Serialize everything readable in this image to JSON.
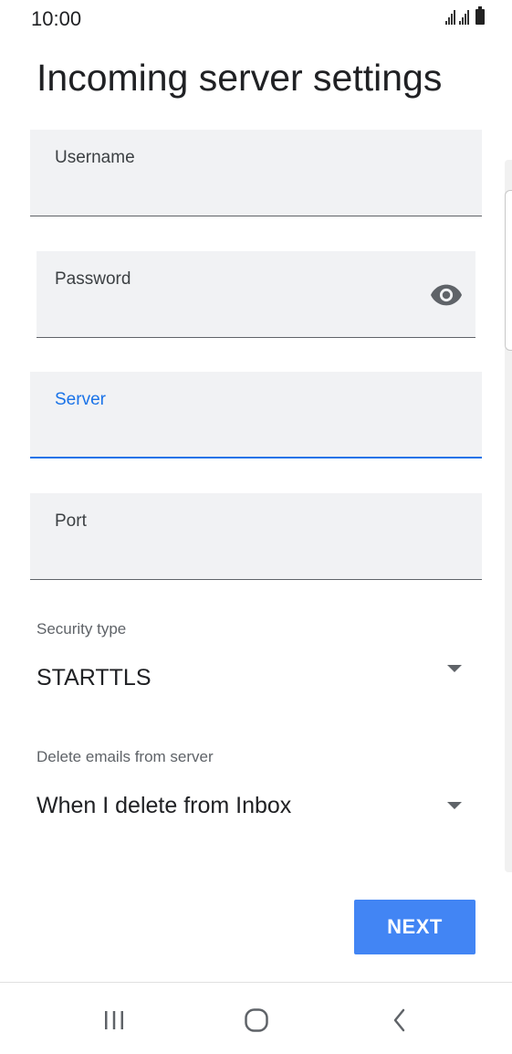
{
  "status_bar": {
    "time": "10:00"
  },
  "page": {
    "title": "Incoming server settings"
  },
  "fields": {
    "username": {
      "label": "Username",
      "value": ""
    },
    "password": {
      "label": "Password",
      "value": ""
    },
    "server": {
      "label": "Server",
      "value": ""
    },
    "port": {
      "label": "Port",
      "value": ""
    }
  },
  "security_type": {
    "label": "Security type",
    "selected": "STARTTLS"
  },
  "delete_emails": {
    "label": "Delete emails from server",
    "selected": "When I delete from Inbox"
  },
  "actions": {
    "next_label": "NEXT"
  },
  "colors": {
    "accent": "#1a73e8",
    "button": "#4285f4",
    "field_bg": "#f1f2f4"
  },
  "icons": {
    "password_toggle": "eye-icon",
    "nav_recents": "recent-apps-icon",
    "nav_home": "home-icon",
    "nav_back": "back-icon"
  }
}
